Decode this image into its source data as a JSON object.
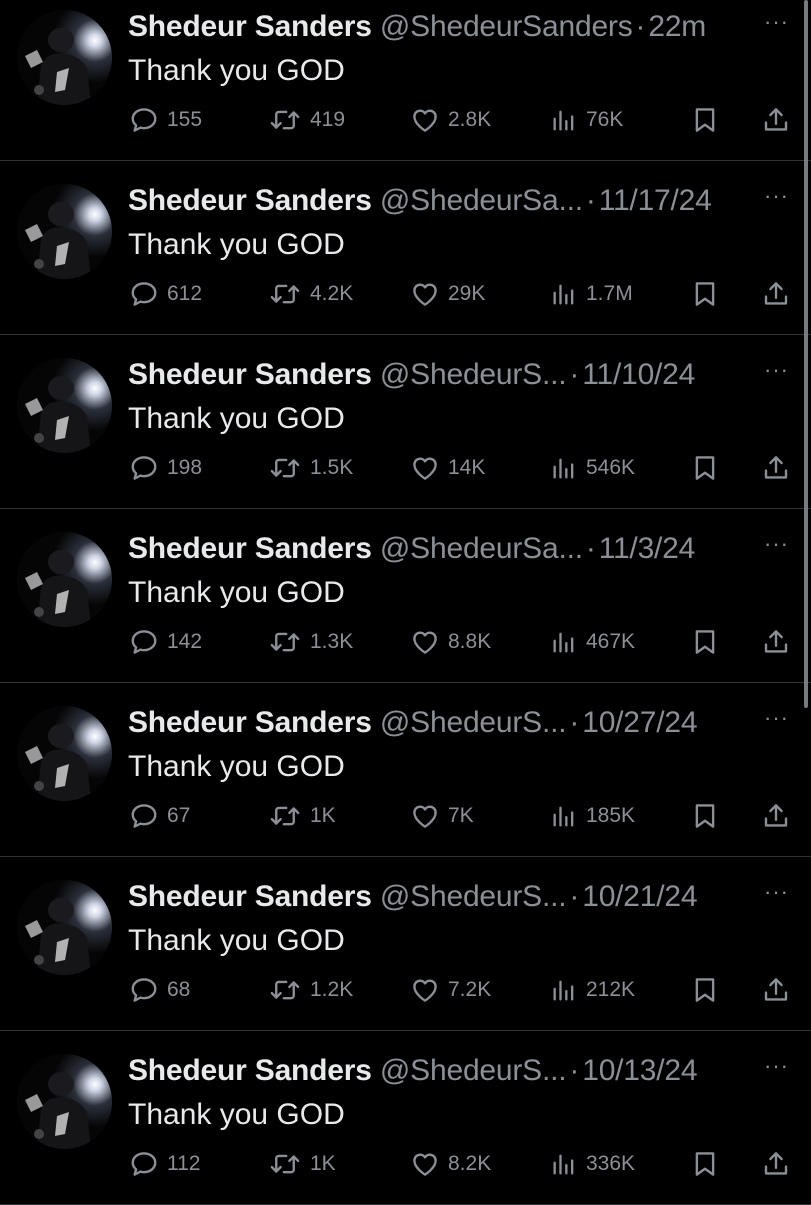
{
  "tweets": [
    {
      "name": "Shedeur Sanders",
      "handle": "@ShedeurSanders",
      "time": "22m",
      "text": "Thank you GOD",
      "replies": "155",
      "reposts": "419",
      "likes": "2.8K",
      "views": "76K"
    },
    {
      "name": "Shedeur Sanders",
      "handle": "@ShedeurSa...",
      "time": "11/17/24",
      "text": "Thank you GOD",
      "replies": "612",
      "reposts": "4.2K",
      "likes": "29K",
      "views": "1.7M"
    },
    {
      "name": "Shedeur Sanders",
      "handle": "@ShedeurS...",
      "time": "11/10/24",
      "text": "Thank you GOD",
      "replies": "198",
      "reposts": "1.5K",
      "likes": "14K",
      "views": "546K"
    },
    {
      "name": "Shedeur Sanders",
      "handle": "@ShedeurSa...",
      "time": "11/3/24",
      "text": "Thank you GOD",
      "replies": "142",
      "reposts": "1.3K",
      "likes": "8.8K",
      "views": "467K"
    },
    {
      "name": "Shedeur Sanders",
      "handle": "@ShedeurS...",
      "time": "10/27/24",
      "text": "Thank you GOD",
      "replies": "67",
      "reposts": "1K",
      "likes": "7K",
      "views": "185K"
    },
    {
      "name": "Shedeur Sanders",
      "handle": "@ShedeurS...",
      "time": "10/21/24",
      "text": "Thank you GOD",
      "replies": "68",
      "reposts": "1.2K",
      "likes": "7.2K",
      "views": "212K"
    },
    {
      "name": "Shedeur Sanders",
      "handle": "@ShedeurS...",
      "time": "10/13/24",
      "text": "Thank you GOD",
      "replies": "112",
      "reposts": "1K",
      "likes": "8.2K",
      "views": "336K"
    }
  ],
  "separator": "·",
  "more_glyph": "···",
  "icons": {
    "reply": "reply-icon",
    "repost": "repost-icon",
    "like": "like-icon",
    "views": "views-icon",
    "bookmark": "bookmark-icon",
    "share": "share-icon",
    "more": "more-icon"
  },
  "colors": {
    "background": "#000000",
    "primary_text": "#e7e9ea",
    "secondary_text": "#8b9096",
    "divider": "#2f3336"
  }
}
